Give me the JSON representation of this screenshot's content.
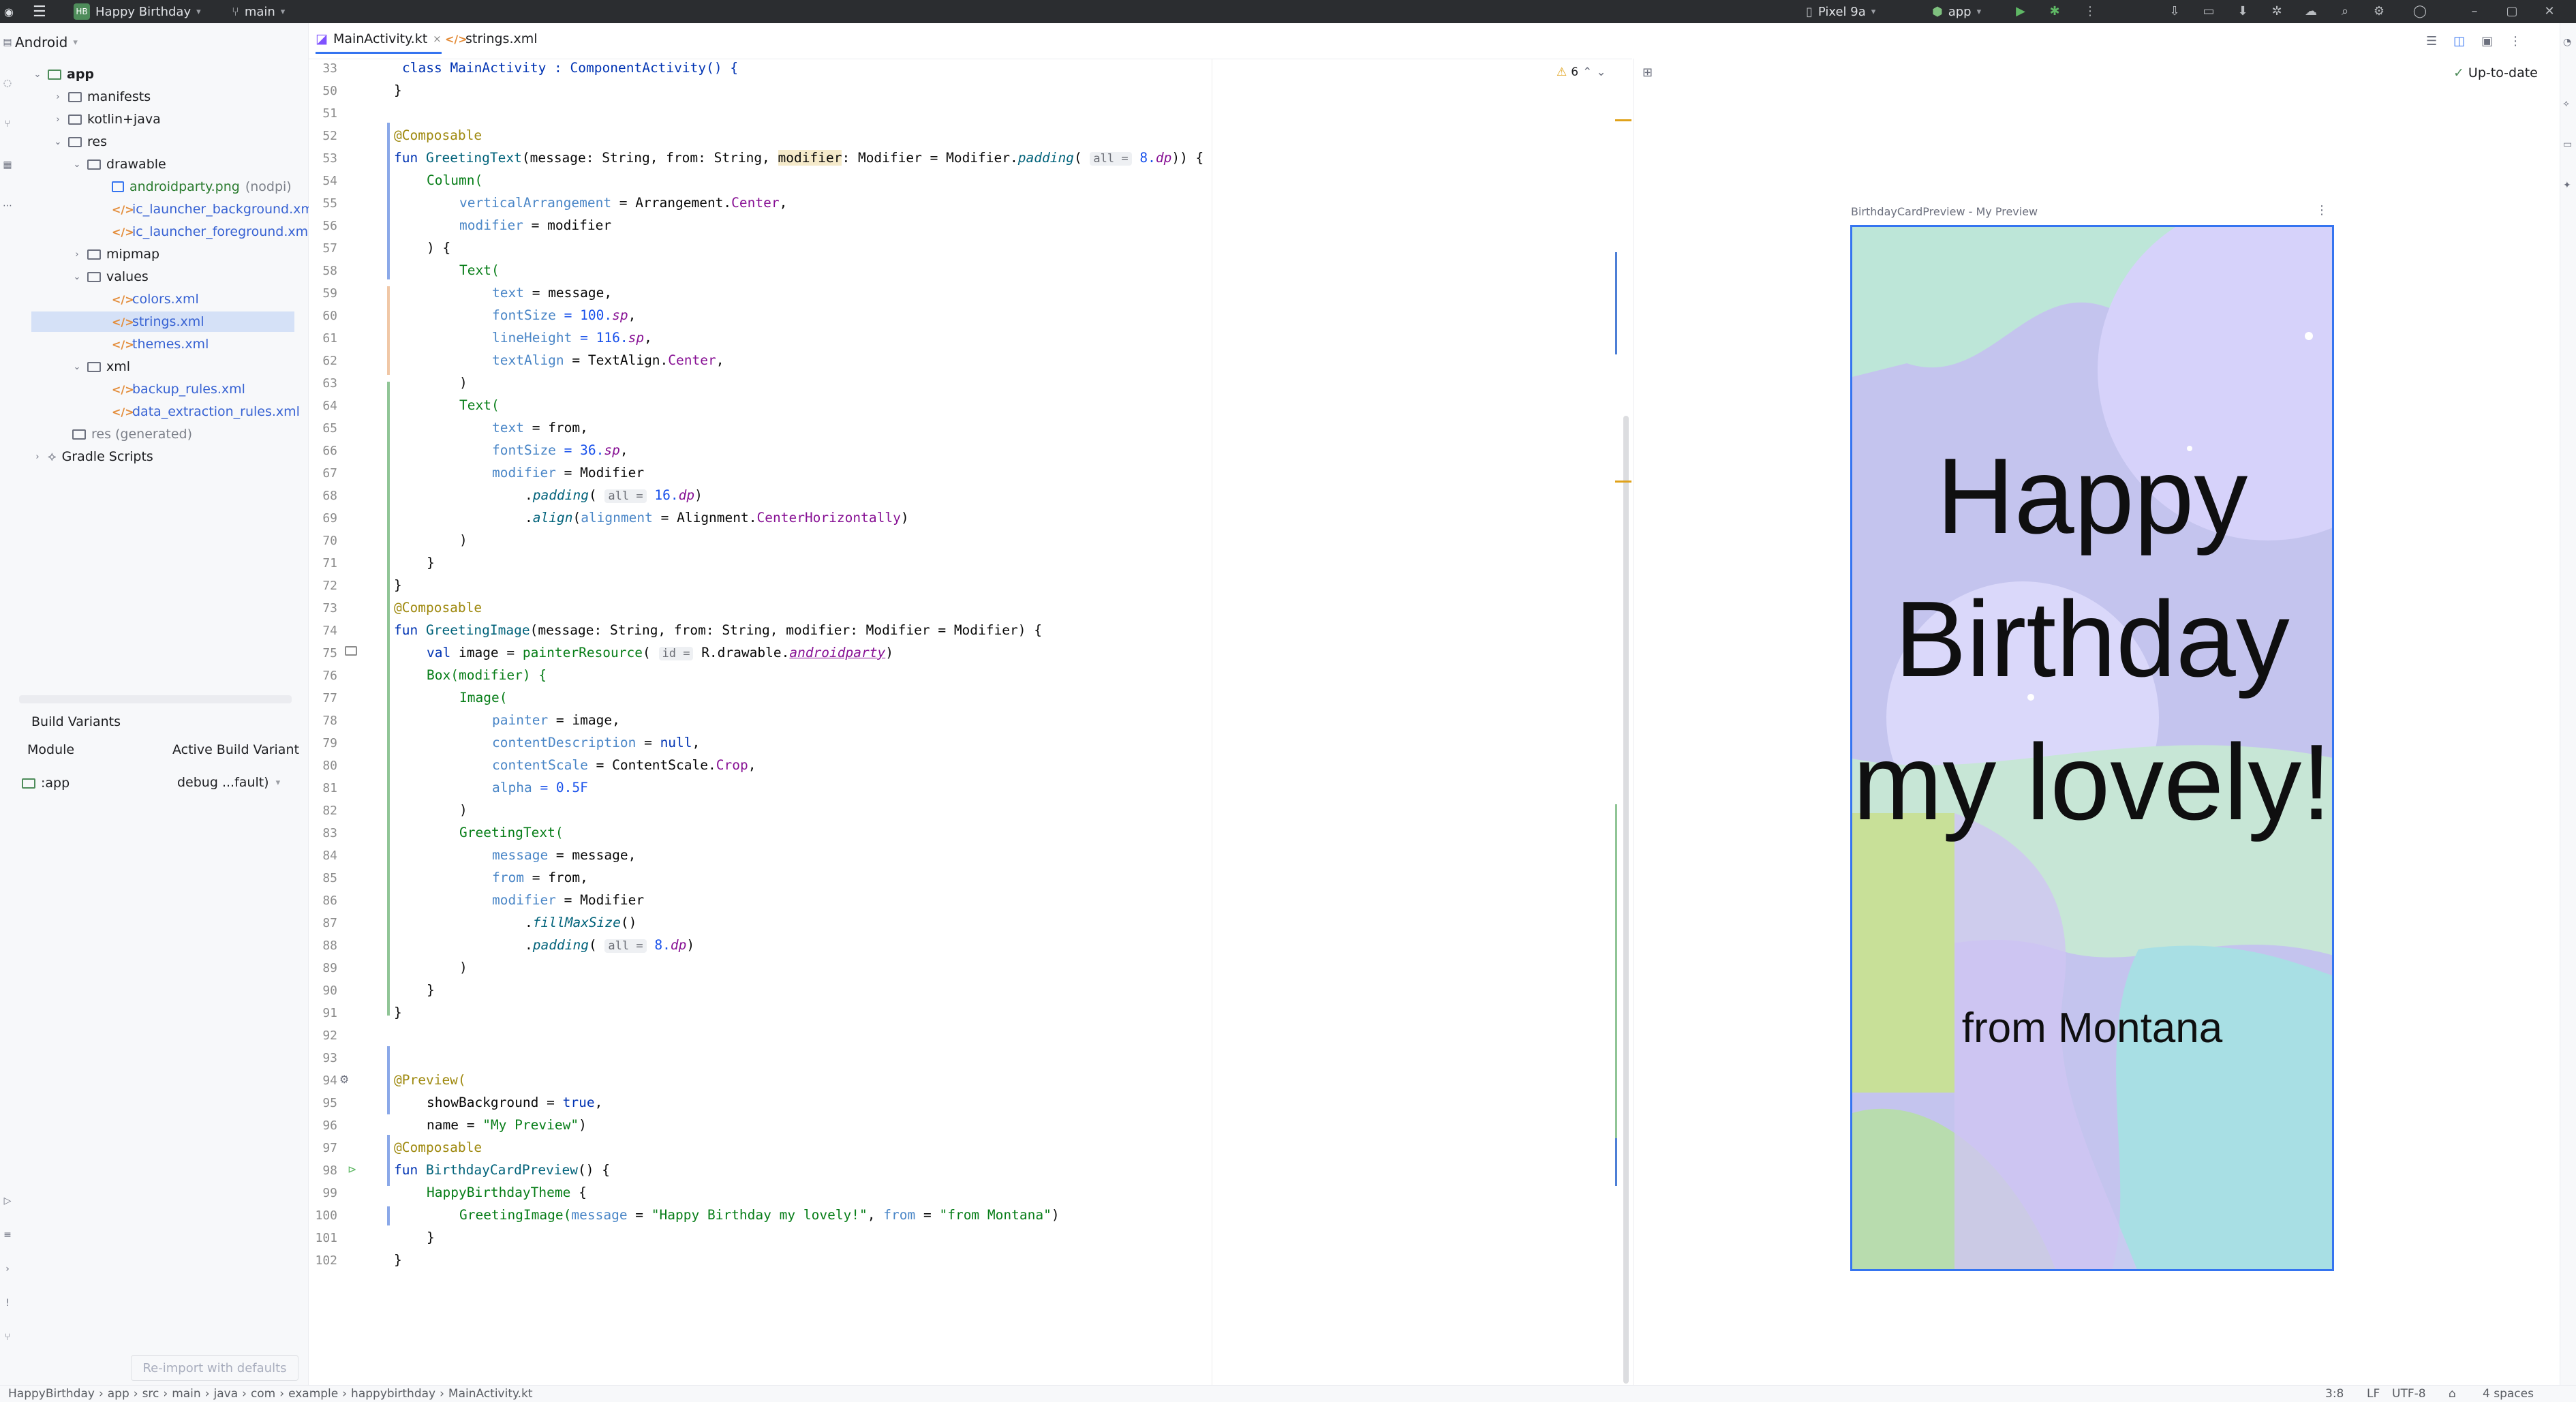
{
  "titlebar": {
    "project_badge": "HB",
    "project_name": "Happy Birthday",
    "branch": "main",
    "device": "Pixel 9a",
    "run_config": "app"
  },
  "project_panel": {
    "view_mode": "Android",
    "tree": {
      "app": "app",
      "manifests": "manifests",
      "kotlin_java": "kotlin+java",
      "res": "res",
      "drawable": "drawable",
      "androidparty": "androidparty.png",
      "androidparty_qual": "(nodpi)",
      "ic_bg": "ic_launcher_background.xml",
      "ic_fg": "ic_launcher_foreground.xml",
      "mipmap": "mipmap",
      "values": "values",
      "colors": "colors.xml",
      "strings": "strings.xml",
      "themes": "themes.xml",
      "xml": "xml",
      "backup": "backup_rules.xml",
      "data_extraction": "data_extraction_rules.xml",
      "res_generated": "res (generated)",
      "gradle": "Gradle Scripts"
    },
    "build_variants": {
      "title": "Build Variants",
      "col_module": "Module",
      "col_variant": "Active Build Variant",
      "module": ":app",
      "variant": "debug ...fault)"
    },
    "reimport_label": "Re-import with defaults"
  },
  "editor": {
    "tabs": [
      "MainActivity.kt",
      "strings.xml"
    ],
    "warning_count": "6",
    "code": {
      "l33": "class MainActivity : ComponentActivity() {",
      "l50": "}",
      "l52": "@Composable",
      "l53_fun": "fun ",
      "l53_name": "GreetingText",
      "l53_sig": "(message: String, from: String, ",
      "l53_mod": "modifier",
      "l53_rest": ": Modifier = Modifier.",
      "l53_pad": "padding",
      "l53_open": "( ",
      "hint_all": "all =",
      "l53_val": " 8.",
      "dp": "dp",
      "l53_close": ")) {",
      "l54": "Column(",
      "l55_k": "verticalArrangement",
      "l55_v": " = Arrangement.",
      "l55_c": "Center",
      "l56_k": "modifier",
      "l56_v": " = modifier",
      "l57": ") {",
      "text_call": "Text(",
      "l59_k": "text",
      "l59_v": " = message,",
      "l60_k": "fontSize",
      "l60_n": " = 100.",
      "sp": "sp",
      "comma": ",",
      "l61_k": "lineHeight",
      "l61_n": " = 116.",
      "l62_k": "textAlign",
      "l62_v": " = TextAlign.",
      "l62_c": "Center",
      "close_paren": ")",
      "l65_v": " = from,",
      "l66_n": " = 36.",
      "l67_v": " = Modifier",
      "dot": ".",
      "padding": "padding",
      "l68_n": " 16.",
      "l68_close": ")",
      "align": "align",
      "alignment": "alignment",
      "l69_v": " = Alignment.",
      "l69_c": "CenterHorizontally",
      "close_brace": "}",
      "l74_sig": "(message: String, from: String, modifier: Modifier = Modifier) {",
      "l74_name": "GreetingImage",
      "l75_val": "val",
      "l75_a": " image = ",
      "l75_fn": "painterResource",
      "hint_id": "id =",
      "l75_b": " R.drawable.",
      "l75_res": "androidparty",
      "l76": "Box(modifier) {",
      "l77": "Image(",
      "l78_k": "painter",
      "l78_v": " = image,",
      "l79_k": "contentDescription",
      "l79_n": " = ",
      "null": "null",
      "l80_k": "contentScale",
      "l80_v": " = ContentScale.",
      "l80_c": "Crop",
      "l81_k": "alpha",
      "l81_n": " = 0.5F",
      "l83": "GreetingText(",
      "l84_k": "message",
      "l84_v": " = message,",
      "l85_k": "from",
      "l85_v": " = from,",
      "l87": "fillMaxSize",
      "l87_p": "()",
      "l88_n": " 8.",
      "l94": "@Preview(",
      "l95_a": "showBackground = ",
      "true": "true",
      "l96_a": "name = ",
      "l96_s": "\"My Preview\"",
      "l98_name": "BirthdayCardPreview",
      "l98_rest": "() {",
      "l99": "HappyBirthdayTheme",
      "l99_b": " {",
      "l100_fn": "GreetingImage(",
      "l100_s1": "\"Happy Birthday my lovely!\"",
      "l100_s2": "\"from Montana\""
    },
    "line_numbers": [
      "33",
      "50",
      "51",
      "52",
      "53",
      "54",
      "55",
      "56",
      "57",
      "58",
      "59",
      "60",
      "61",
      "62",
      "63",
      "64",
      "65",
      "66",
      "67",
      "68",
      "69",
      "70",
      "71",
      "72",
      "73",
      "74",
      "75",
      "76",
      "77",
      "78",
      "79",
      "80",
      "81",
      "82",
      "83",
      "84",
      "85",
      "86",
      "87",
      "88",
      "89",
      "90",
      "91",
      "92",
      "93",
      "94",
      "95",
      "96",
      "97",
      "98",
      "99",
      "100",
      "101",
      "102"
    ]
  },
  "preview": {
    "status": "Up-to-date",
    "label": "BirthdayCardPreview - My Preview",
    "message": "Happy Birthday my lovely!",
    "from": "from Montana"
  },
  "statusbar": {
    "breadcrumbs": [
      "HappyBirthday",
      "app",
      "src",
      "main",
      "java",
      "com",
      "example",
      "happybirthday",
      "MainActivity.kt"
    ],
    "position": "3:8",
    "line_sep": "LF",
    "encoding": "UTF-8",
    "indent": "4 spaces"
  },
  "colors": {
    "accent": "#3574f0",
    "titlebar_bg": "#2b2d30",
    "panel_bg": "#f7f8fa",
    "keyword": "#0033b3",
    "composable": "#067d17",
    "annotation": "#9e880d"
  }
}
